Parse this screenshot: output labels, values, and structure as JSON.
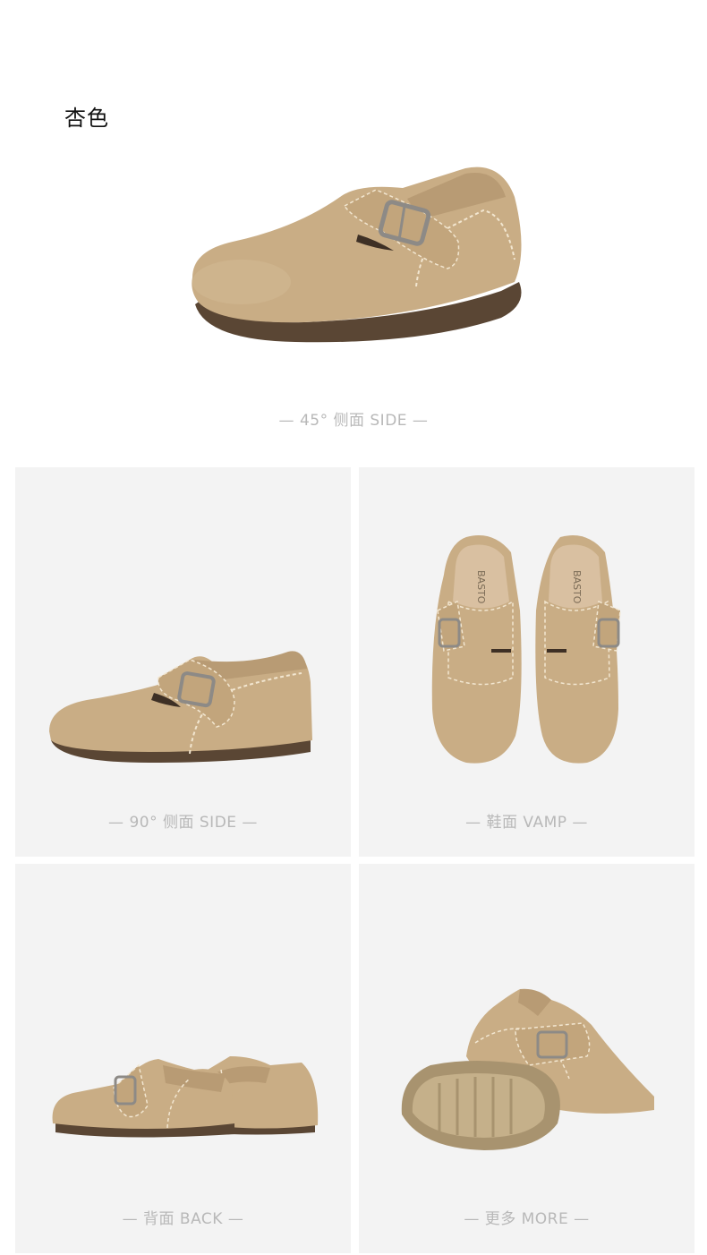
{
  "header": {
    "color_name": "杏色"
  },
  "hero": {
    "caption": "— 45°  侧面 SIDE —"
  },
  "views": [
    {
      "caption": "— 90°  侧面 SIDE —"
    },
    {
      "caption": "— 鞋面 VAMP —",
      "insole_brand": "BASTO"
    },
    {
      "caption": "— 背面 BACK —"
    },
    {
      "caption": "— 更多 MORE —"
    }
  ],
  "colors": {
    "suede": "#c9ad85",
    "sole": "#5a4634",
    "panel_bg": "#f3f3f3",
    "caption": "#b8b8b8"
  }
}
